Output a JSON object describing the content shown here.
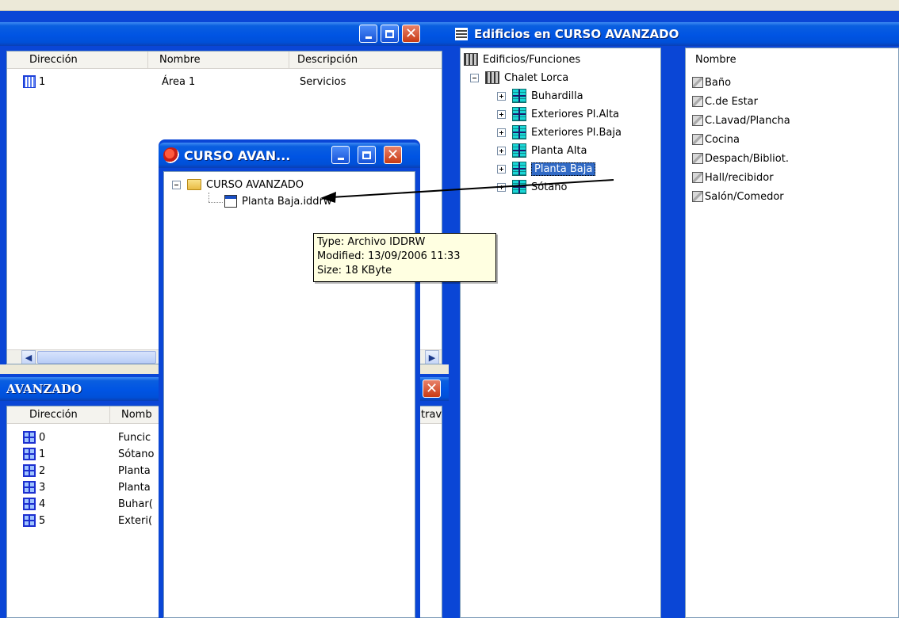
{
  "left_top_window": {
    "columns": [
      "Dirección",
      "Nombre",
      "Descripción"
    ],
    "rows": [
      {
        "dir": "1",
        "name": "Área 1",
        "desc": "Servicios"
      }
    ]
  },
  "left_bottom_window": {
    "title": "AVANZADO",
    "columns": [
      "Dirección",
      "Nomb",
      "trav"
    ],
    "rows": [
      {
        "dir": "0",
        "name": "Funcic"
      },
      {
        "dir": "1",
        "name": "Sótano"
      },
      {
        "dir": "2",
        "name": "Planta"
      },
      {
        "dir": "3",
        "name": "Planta"
      },
      {
        "dir": "4",
        "name": "Buhar("
      },
      {
        "dir": "5",
        "name": "Exteri("
      }
    ]
  },
  "curso_window": {
    "title": "CURSO AVAN...",
    "folder": "CURSO AVANZADO",
    "file": "Planta Baja.iddrw",
    "tooltip": {
      "type": "Type: Archivo IDDRW",
      "modified": "Modified: 13/09/2006 11:33",
      "size": "Size: 18 KByte"
    }
  },
  "edificios_window": {
    "title": "Edificios en CURSO AVANZADO",
    "root": "Edificios/Funciones",
    "building": "Chalet Lorca",
    "floors": [
      "Buhardilla",
      "Exteriores Pl.Alta",
      "Exteriores Pl.Baja",
      "Planta Alta",
      "Planta Baja",
      "Sótano"
    ],
    "selected_floor": "Planta Baja",
    "rooms_header": "Nombre",
    "rooms": [
      "Baño",
      "C.de Estar",
      "C.Lavad/Plancha",
      "Cocina",
      "Despach/Bibliot.",
      "Hall/recibidor",
      "Salón/Comedor"
    ]
  },
  "colors": {
    "titlebar_blue": "#0054e3",
    "selection": "#316ac5",
    "tooltip_bg": "#ffffe1"
  }
}
